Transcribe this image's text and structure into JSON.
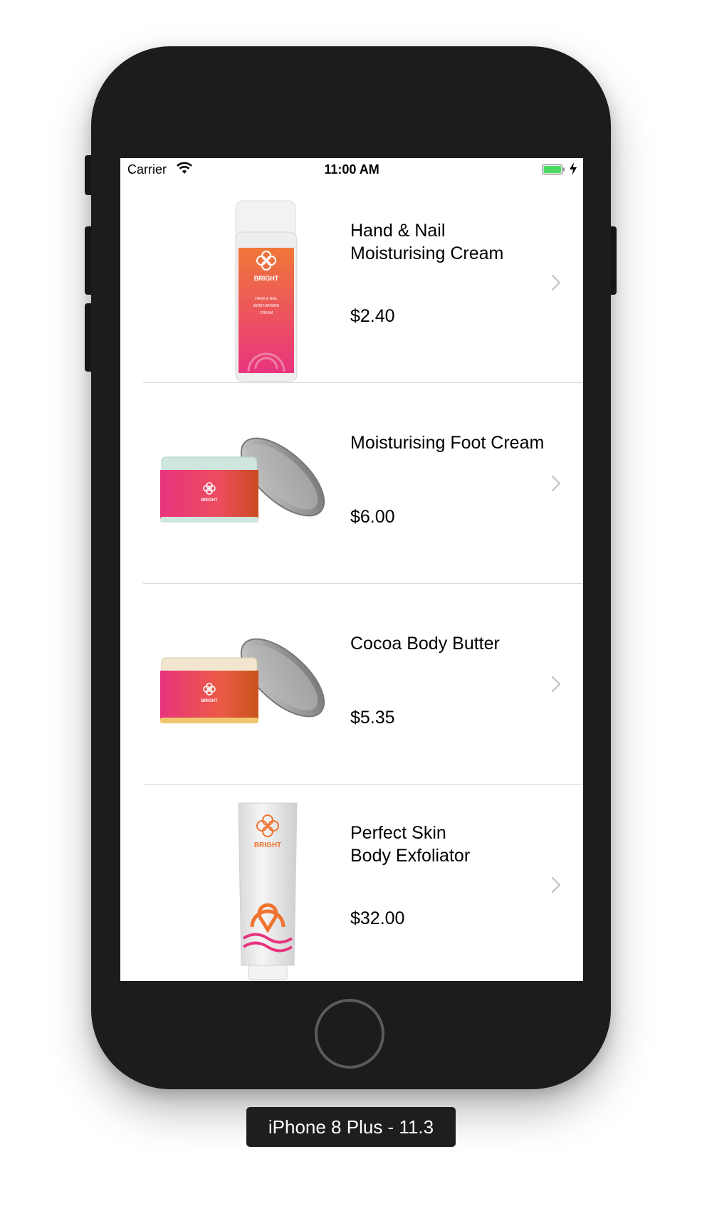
{
  "status_bar": {
    "carrier": "Carrier",
    "time": "11:00 AM",
    "wifi_icon": "wifi-icon",
    "battery_icon": "battery-icon",
    "charging_icon": "bolt-icon"
  },
  "products": [
    {
      "name": "Hand & Nail\nMoisturising Cream",
      "price": "$2.40",
      "image": "pump-bottle"
    },
    {
      "name": "Moisturising Foot Cream",
      "price": "$6.00",
      "image": "jar-green"
    },
    {
      "name": "Cocoa Body Butter",
      "price": "$5.35",
      "image": "jar-cream"
    },
    {
      "name": "Perfect Skin\nBody Exfoliator",
      "price": "$32.00",
      "image": "tube"
    }
  ],
  "thumb_text": {
    "brand": "BRIGHT",
    "bottle_label_1": "HAND & NAIL",
    "bottle_label_2": "MOISTURISING",
    "bottle_label_3": "CREAM"
  },
  "simulator_label": "iPhone 8 Plus - 11.3",
  "colors": {
    "device": "#1c1c1c",
    "label_pink": "#e8347e",
    "label_orange": "#f0742f",
    "separator": "#d9d9db",
    "chevron": "#c7c7cc",
    "battery_green": "#4cd964"
  }
}
